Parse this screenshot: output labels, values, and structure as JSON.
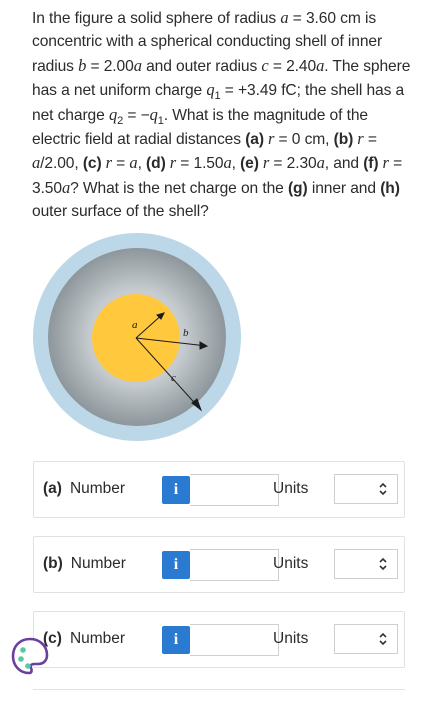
{
  "problem": {
    "s1": "In the figure a solid sphere of radius ",
    "s2": "a",
    "s3": " = 3.60 cm is concentric with a spherical conducting shell of inner radius ",
    "s4": "b",
    "s5": " = 2.00",
    "s6": "a",
    "s7": " and outer radius ",
    "s8": "c",
    "s9": " = 2.40",
    "s10": "a",
    "s11": ". The sphere has a net uniform charge ",
    "s12": "q",
    "s13": "1",
    "s14": " = +3.49 fC; the shell has a net charge ",
    "s15": "q",
    "s16": "2",
    "s17": " = −",
    "s18": "q",
    "s19": "1",
    "s20": ". What is the magnitude of the electric field at radial distances ",
    "s21": "(a)",
    "s22": " r",
    "s23": " = 0 cm, ",
    "s24": "(b)",
    "s25": " r",
    "s26": " = ",
    "s27": "a",
    "s28": "/2.00, ",
    "s29": "(c)",
    "s30": " r",
    "s31": " = ",
    "s32": "a",
    "s33": ", ",
    "s34": "(d)",
    "s35": " r",
    "s36": " = 1.50",
    "s37": "a",
    "s38": ", ",
    "s39": "(e)",
    "s40": " r",
    "s41": " = 2.30",
    "s42": "a",
    "s43": ", and ",
    "s44": "(f)",
    "s45": " r",
    "s46": " = 3.50",
    "s47": "a",
    "s48": "? What is the net charge on the ",
    "s49": "(g)",
    "s50": " inner and ",
    "s51": "(h)",
    "s52": " outer surface of the shell?"
  },
  "figure": {
    "label_a": "a",
    "label_b": "b",
    "label_c": "c",
    "colors": {
      "inner_sphere": "#ffc83d",
      "shell": "#bcd8e8",
      "gap": "#9fa8ad"
    }
  },
  "rows": [
    {
      "part": "(a)",
      "number_label": "Number",
      "info_icon": "i",
      "units_label": "Units",
      "value": "",
      "units_value": ""
    },
    {
      "part": "(b)",
      "number_label": "Number",
      "info_icon": "i",
      "units_label": "Units",
      "value": "",
      "units_value": ""
    },
    {
      "part": "(c)",
      "number_label": "Number",
      "info_icon": "i",
      "units_label": "Units",
      "value": "",
      "units_value": ""
    }
  ],
  "colors": {
    "accent": "#2a7ad1",
    "helper_icon": "#6b3fa0",
    "helper_dots": "#5bc6a3"
  }
}
